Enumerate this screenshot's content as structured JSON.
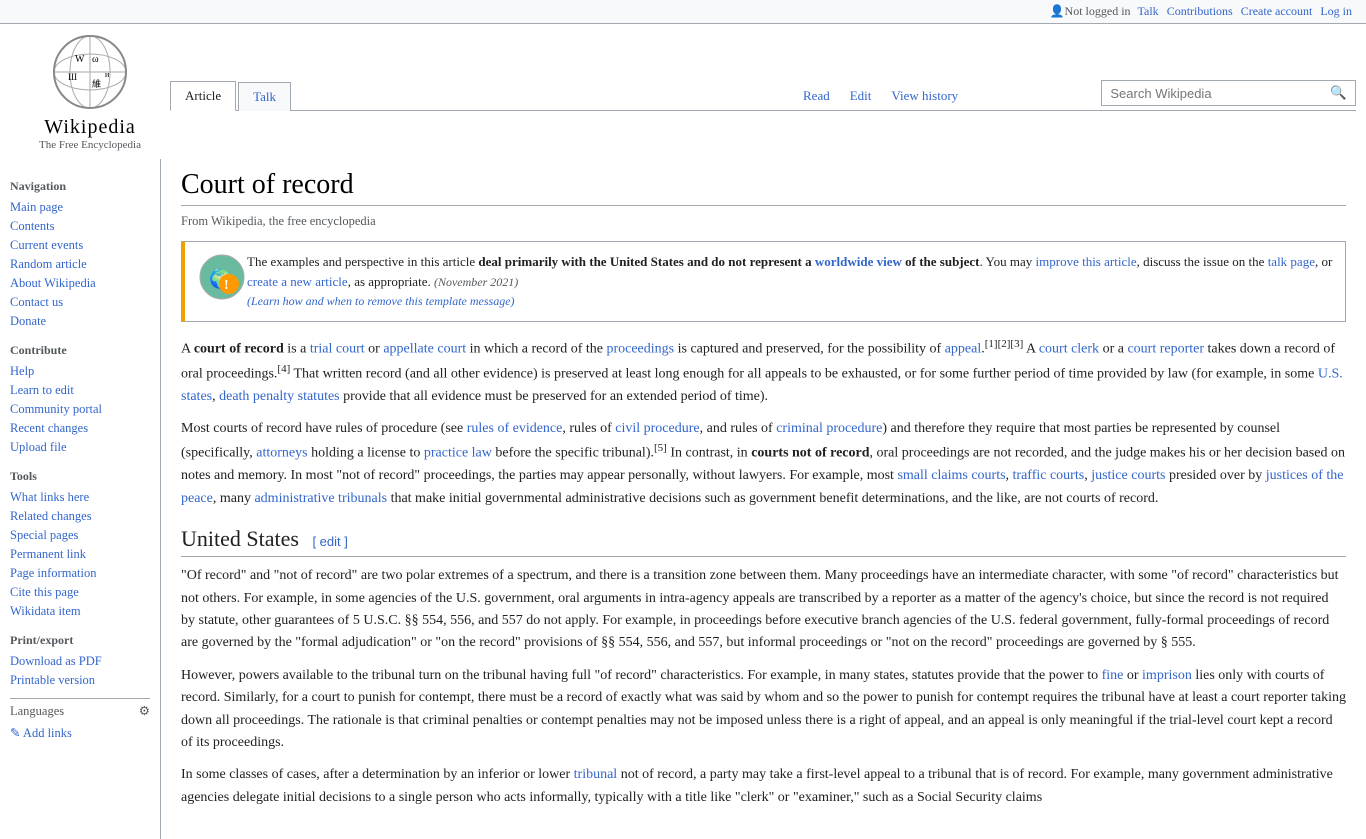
{
  "topbar": {
    "not_logged_in": "Not logged in",
    "talk": "Talk",
    "contributions": "Contributions",
    "create_account": "Create account",
    "log_in": "Log in"
  },
  "logo": {
    "title": "Wikipedia",
    "subtitle": "The Free Encyclopedia"
  },
  "tabs": {
    "article": "Article",
    "talk": "Talk"
  },
  "view_tabs": {
    "read": "Read",
    "edit": "Edit",
    "view_history": "View history"
  },
  "search": {
    "placeholder": "Search Wikipedia"
  },
  "sidebar": {
    "navigation_title": "Navigation",
    "main_page": "Main page",
    "contents": "Contents",
    "current_events": "Current events",
    "random_article": "Random article",
    "about": "About Wikipedia",
    "contact": "Contact us",
    "donate": "Donate",
    "contribute_title": "Contribute",
    "help": "Help",
    "learn_to_edit": "Learn to edit",
    "community_portal": "Community portal",
    "recent_changes": "Recent changes",
    "upload_file": "Upload file",
    "tools_title": "Tools",
    "what_links_here": "What links here",
    "related_changes": "Related changes",
    "special_pages": "Special pages",
    "permanent_link": "Permanent link",
    "page_information": "Page information",
    "cite_this_page": "Cite this page",
    "wikidata_item": "Wikidata item",
    "print_title": "Print/export",
    "download_pdf": "Download as PDF",
    "printable_version": "Printable version",
    "languages_title": "Languages",
    "add_links": "Add links"
  },
  "article": {
    "title": "Court of record",
    "subtitle": "From Wikipedia, the free encyclopedia",
    "notice": {
      "text_bold_start": "deal primarily with the United States and do not represent a",
      "worldwide_view": "worldwide view",
      "text_bold_end": "of the subject",
      "text_before": "The examples and perspective in this article ",
      "text_after": ". You may ",
      "improve_link": "improve this article",
      "talk_text": ", discuss the issue on the ",
      "talk_link": "talk page",
      "or_text": ", or ",
      "create_link": "create a new article",
      "as_appropriate": ", as appropriate.",
      "date": " (November 2021)",
      "learn": "(Learn how and when to remove this template message)"
    },
    "para1": "A court of record is a trial court or appellate court in which a record of the proceedings is captured and preserved, for the possibility of appeal.[1][2][3] A court clerk or a court reporter takes down a record of oral proceedings.[4] That written record (and all other evidence) is preserved at least long enough for all appeals to be exhausted, or for some further period of time provided by law (for example, in some U.S. states, death penalty statutes provide that all evidence must be preserved for an extended period of time).",
    "para2": "Most courts of record have rules of procedure (see rules of evidence, rules of civil procedure, and rules of criminal procedure) and therefore they require that most parties be represented by counsel (specifically, attorneys holding a license to practice law before the specific tribunal).[5] In contrast, in courts not of record, oral proceedings are not recorded, and the judge makes his or her decision based on notes and memory. In most \"not of record\" proceedings, the parties may appear personally, without lawyers. For example, most small claims courts, traffic courts, justice courts presided over by justices of the peace, many administrative tribunals that make initial governmental administrative decisions such as government benefit determinations, and the like, are not courts of record.",
    "section_us": "United States",
    "edit_link": "edit",
    "para3": "\"Of record\" and \"not of record\" are two polar extremes of a spectrum, and there is a transition zone between them. Many proceedings have an intermediate character, with some \"of record\" characteristics but not others. For example, in some agencies of the U.S. government, oral arguments in intra-agency appeals are transcribed by a reporter as a matter of the agency's choice, but since the record is not required by statute, other guarantees of 5 U.S.C. §§ 554, 556, and 557 do not apply. For example, in proceedings before executive branch agencies of the U.S. federal government, fully-formal proceedings of record are governed by the \"formal adjudication\" or \"on the record\" provisions of §§ 554, 556, and 557, but informal proceedings or \"not on the record\" proceedings are governed by § 555.",
    "para4": "However, powers available to the tribunal turn on the tribunal having full \"of record\" characteristics. For example, in many states, statutes provide that the power to fine or imprison lies only with courts of record. Similarly, for a court to punish for contempt, there must be a record of exactly what was said by whom and so the power to punish for contempt requires the tribunal have at least a court reporter taking down all proceedings. The rationale is that criminal penalties or contempt penalties may not be imposed unless there is a right of appeal, and an appeal is only meaningful if the trial-level court kept a record of its proceedings.",
    "para5": "In some classes of cases, after a determination by an inferior or lower tribunal not of record, a party may take a first-level appeal to a tribunal that is of record. For example, many government administrative agencies delegate initial decisions to a single person who acts informally, typically with a title like \"clerk\" or \"examiner,\" such as a Social Security claims"
  }
}
